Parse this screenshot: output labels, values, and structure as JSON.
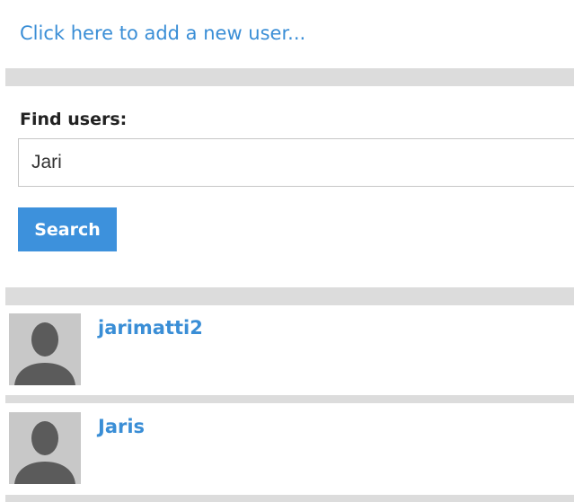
{
  "header": {
    "add_user_link": "Click here to add a new user..."
  },
  "search": {
    "label": "Find users:",
    "value": "Jari",
    "button_label": "Search"
  },
  "results": [
    {
      "username": "jarimatti2",
      "avatar_icon": "default-user-avatar-icon"
    },
    {
      "username": "Jaris",
      "avatar_icon": "default-user-avatar-icon"
    }
  ],
  "colors": {
    "link": "#3a8ed6",
    "button": "#3d91dc",
    "divider": "#dcdcdc"
  }
}
